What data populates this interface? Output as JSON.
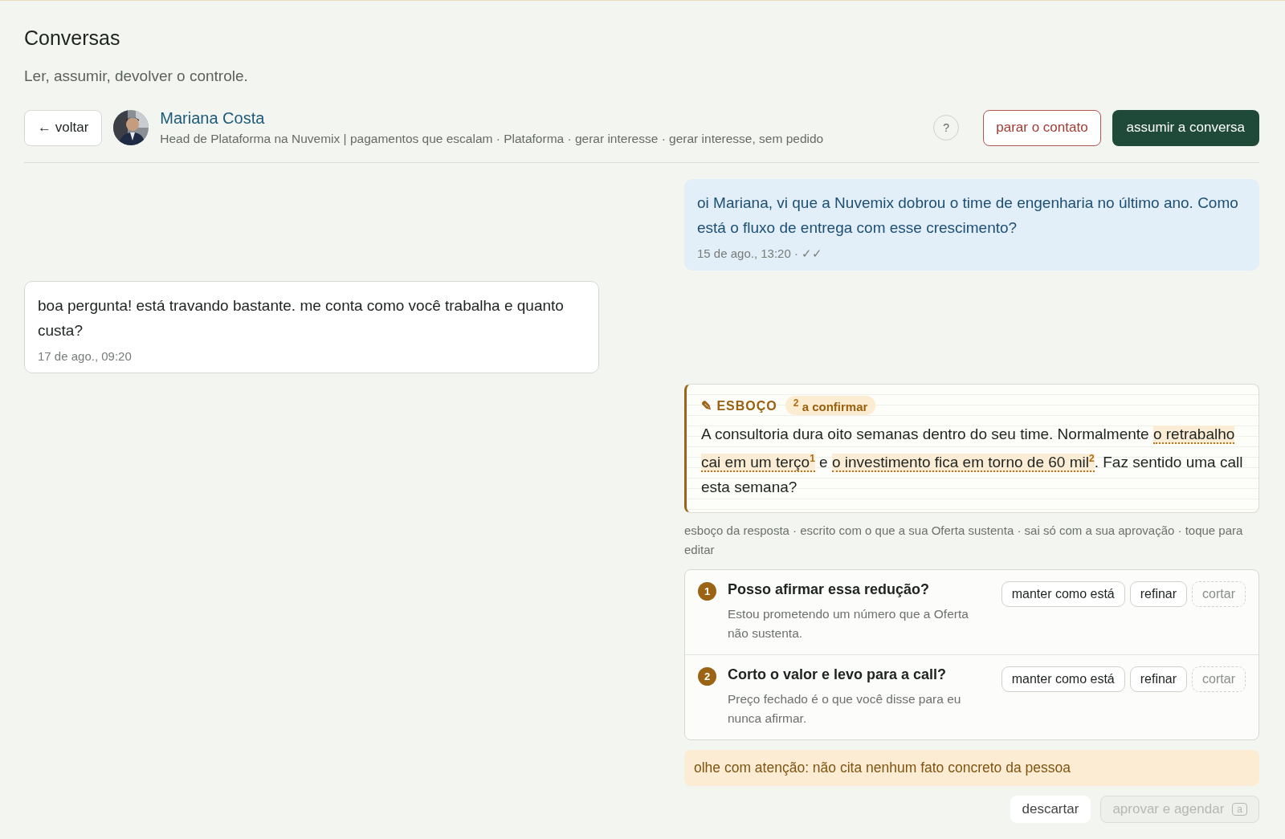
{
  "page": {
    "title": "Conversas",
    "subtitle": "Ler, assumir, devolver o controle."
  },
  "header": {
    "back_button": "← voltar",
    "contact": {
      "name": "Mariana Costa",
      "details": "Head de Plataforma na Nuvemix | pagamentos que escalam · Plataforma · gerar interesse · gerar interesse, sem pedido"
    },
    "help_button": "?",
    "stop_button": "parar o contato",
    "takeover_button": "assumir a conversa"
  },
  "messages": [
    {
      "kind": "sent",
      "text": "oi Mariana, vi que a Nuvemix dobrou o time de engenharia no último ano. Como está o fluxo de entrega com esse crescimento?",
      "meta": "15 de ago., 13:20 · ✓✓"
    },
    {
      "kind": "received",
      "text": "boa pergunta! está travando bastante. me conta como você trabalha e quanto custa?",
      "meta": "17 de ago., 09:20"
    }
  ],
  "draft": {
    "label_icon": "✎",
    "label": "ESBOÇO",
    "pending_count": "2",
    "pending_label": "a confirmar",
    "segments": [
      {
        "text": "A consultoria dura oito semanas dentro do seu time. Normalmente "
      },
      {
        "text": "o retrabalho cai em um terço",
        "claim": "1"
      },
      {
        "text": " e "
      },
      {
        "text": "o investimento fica em torno de 60 mil",
        "claim": "2"
      },
      {
        "text": ". Faz sentido uma call esta semana?"
      }
    ],
    "caption": "esboço da resposta · escrito com o que a sua Oferta sustenta · sai só com a sua aprovação · toque para editar",
    "questions": [
      {
        "number": "1",
        "title": "Posso afirmar essa redução?",
        "detail": "Estou prometendo um número que a Oferta não sustenta.",
        "actions": [
          {
            "label": "manter como está",
            "kind": "keep"
          },
          {
            "label": "refinar",
            "kind": "refine"
          },
          {
            "label": "cortar",
            "kind": "cut"
          }
        ]
      },
      {
        "number": "2",
        "title": "Corto o valor e levo para a call?",
        "detail": "Preço fechado é o que você disse para eu nunca afirmar.",
        "actions": [
          {
            "label": "manter como está",
            "kind": "keep"
          },
          {
            "label": "refinar",
            "kind": "refine"
          },
          {
            "label": "cortar",
            "kind": "cut"
          }
        ]
      }
    ],
    "warning": "olhe com atenção: não cita nenhum fato concreto da pessoa",
    "buttons": [
      {
        "label": "descartar",
        "kind": "secondary",
        "disabled": false
      },
      {
        "label": "aprovar e agendar",
        "kind": "primary",
        "disabled": true,
        "shortcut": "a"
      }
    ]
  }
}
